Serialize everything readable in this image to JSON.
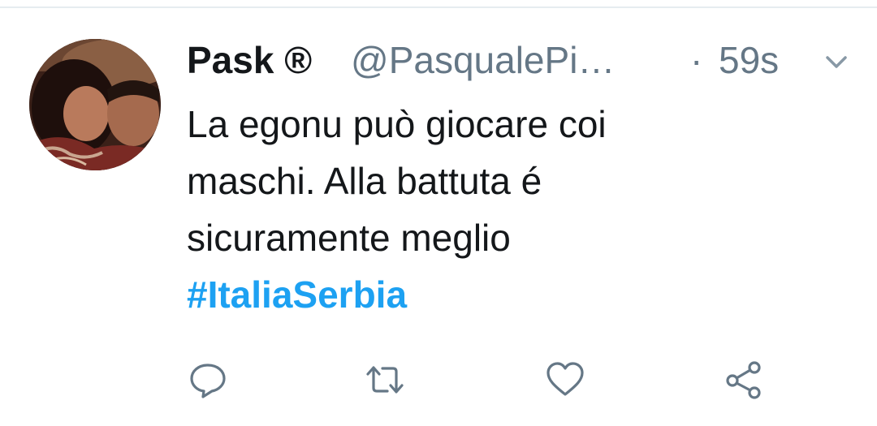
{
  "tweet": {
    "display_name": "Pask ®",
    "handle": "@PasqualePi…",
    "separator": "·",
    "time": "59s",
    "text_lines": [
      "La egonu può giocare coi",
      "maschi. Alla battuta é",
      "sicuramente meglio"
    ],
    "hashtag": "#ItaliaSerbia"
  },
  "icons": {
    "caret": "chevron-down-icon",
    "reply": "reply-icon",
    "retweet": "retweet-icon",
    "like": "heart-icon",
    "share": "share-icon"
  },
  "colors": {
    "text": "#14171a",
    "muted": "#657786",
    "link": "#1da1f2",
    "divider": "#e6ecf0"
  }
}
